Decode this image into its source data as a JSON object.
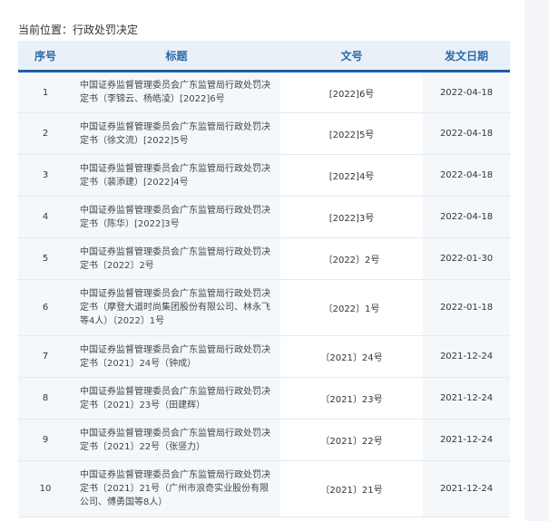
{
  "breadcrumb": "当前位置：行政处罚决定",
  "table": {
    "headers": {
      "index": "序号",
      "title": "标题",
      "doc_no": "文号",
      "date": "发文日期"
    },
    "rows": [
      {
        "index": "1",
        "title": "中国证券监督管理委员会广东监管局行政处罚决定书（李锦云、杨皓凌）[2022]6号",
        "doc_no": "[2022]6号",
        "date": "2022-04-18"
      },
      {
        "index": "2",
        "title": "中国证券监督管理委员会广东监管局行政处罚决定书（徐文流）[2022]5号",
        "doc_no": "[2022]5号",
        "date": "2022-04-18"
      },
      {
        "index": "3",
        "title": "中国证券监督管理委员会广东监管局行政处罚决定书（裴添建）[2022]4号",
        "doc_no": "[2022]4号",
        "date": "2022-04-18"
      },
      {
        "index": "4",
        "title": "中国证券监督管理委员会广东监管局行政处罚决定书（陈华）[2022]3号",
        "doc_no": "[2022]3号",
        "date": "2022-04-18"
      },
      {
        "index": "5",
        "title": "中国证券监督管理委员会广东监管局行政处罚决定书〔2022〕2号",
        "doc_no": "〔2022〕2号",
        "date": "2022-01-30"
      },
      {
        "index": "6",
        "title": "中国证券监督管理委员会广东监管局行政处罚决定书（摩登大道时尚集团股份有限公司、林永飞等4人）〔2022〕1号",
        "doc_no": "〔2022〕1号",
        "date": "2022-01-18"
      },
      {
        "index": "7",
        "title": "中国证券监督管理委员会广东监管局行政处罚决定书〔2021〕24号（钟成）",
        "doc_no": "〔2021〕24号",
        "date": "2021-12-24"
      },
      {
        "index": "8",
        "title": "中国证券监督管理委员会广东监管局行政处罚决定书〔2021〕23号（田建辉）",
        "doc_no": "〔2021〕23号",
        "date": "2021-12-24"
      },
      {
        "index": "9",
        "title": "中国证券监督管理委员会广东监管局行政处罚决定书〔2021〕22号（张竖力）",
        "doc_no": "〔2021〕22号",
        "date": "2021-12-24"
      },
      {
        "index": "10",
        "title": "中国证券监督管理委员会广东监管局行政处罚决定书〔2021〕21号（广州市浪奇实业股份有限公司、傅勇国等8人）",
        "doc_no": "〔2021〕21号",
        "date": "2021-12-24"
      }
    ]
  }
}
